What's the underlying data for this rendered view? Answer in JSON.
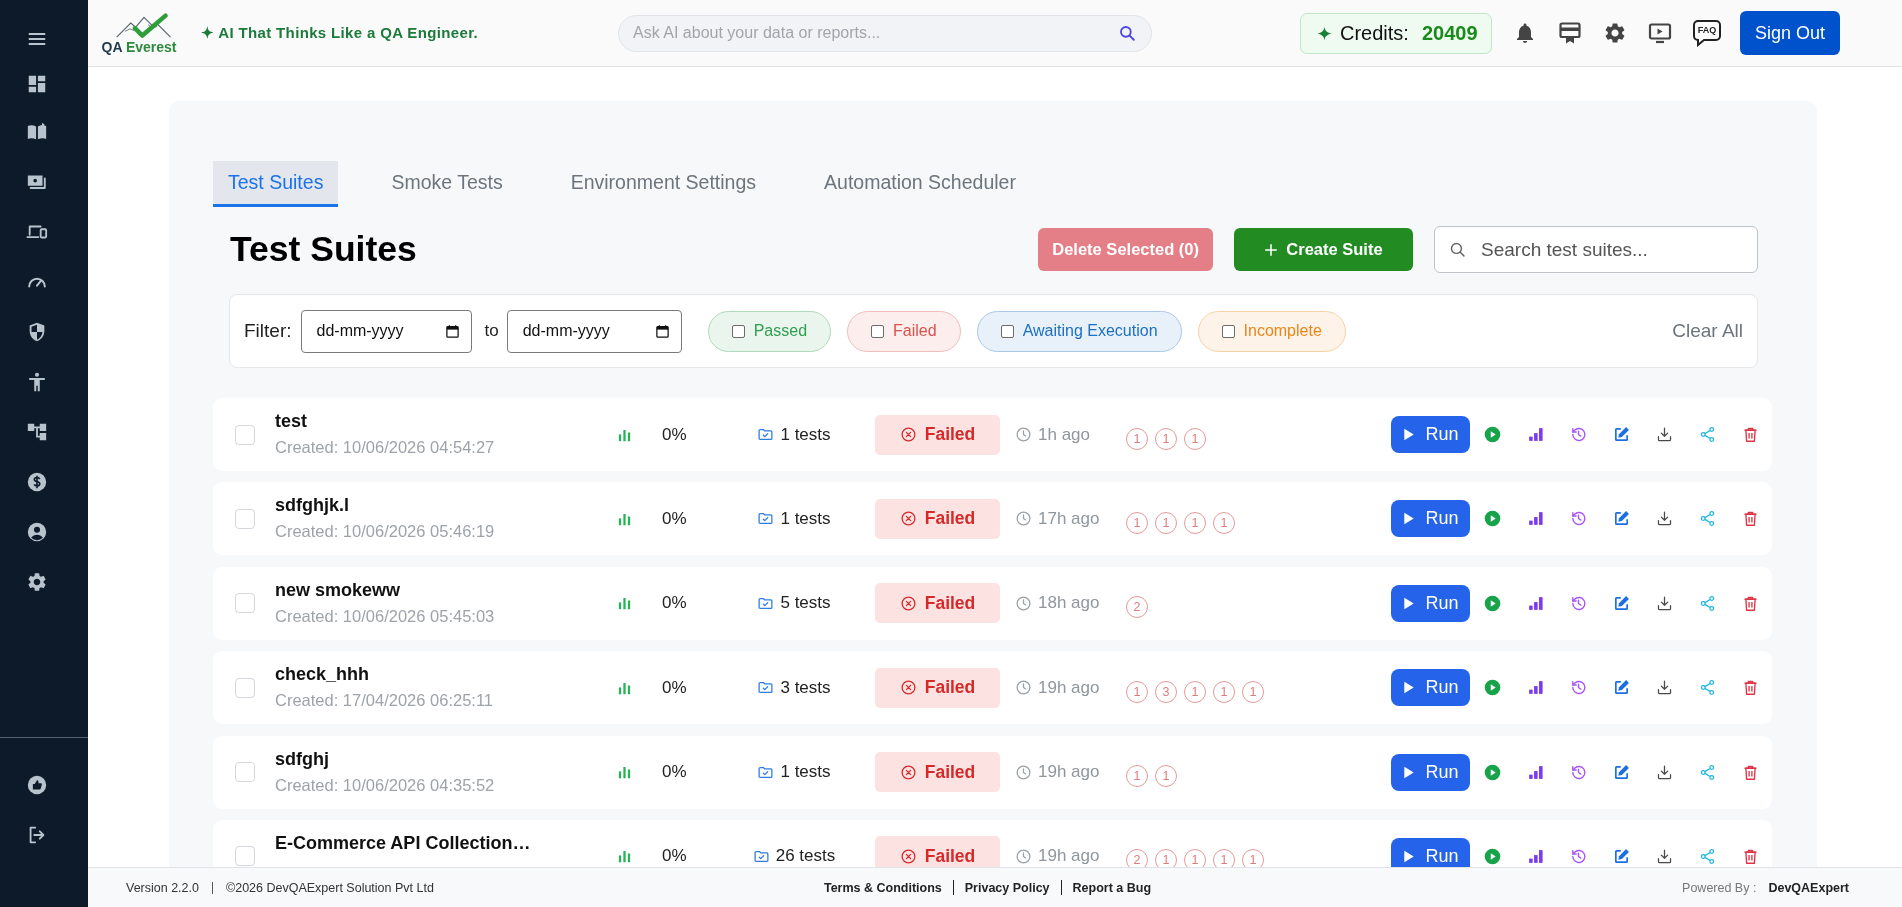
{
  "header": {
    "logo_words": [
      "QA",
      "Everest"
    ],
    "tagline": "✦ AI That Thinks Like a QA Engineer.",
    "ai_search": {
      "placeholder": "Ask AI about your data or reports..."
    },
    "credits": {
      "label": "Credits:",
      "value": "20409"
    },
    "faq": "FAQ",
    "sign_out": "Sign Out"
  },
  "tabs": [
    {
      "label": "Test Suites",
      "selected": true
    },
    {
      "label": "Smoke Tests",
      "selected": false
    },
    {
      "label": "Environment Settings",
      "selected": false
    },
    {
      "label": "Automation Scheduler",
      "selected": false
    }
  ],
  "title": "Test Suites",
  "actions": {
    "delete": {
      "label": "Delete Selected (0)",
      "disabled": true
    },
    "create": {
      "label": "Create Suite"
    },
    "search": {
      "placeholder": "Search test suites..."
    }
  },
  "filter": {
    "label": "Filter:",
    "from": {
      "placeholder": "dd-mm-yyyy"
    },
    "to_label": "to",
    "to": {
      "placeholder": "dd-mm-yyyy"
    },
    "chips": [
      {
        "label": "Passed",
        "color": "#2e9e4f",
        "checked": false
      },
      {
        "label": "Failed",
        "color": "#d9534f",
        "checked": false
      },
      {
        "label": "Awaiting Execution",
        "color": "#1d6fc2",
        "checked": false
      },
      {
        "label": "Incomplete",
        "color": "#e8861a",
        "checked": false
      }
    ],
    "clear": "Clear All"
  },
  "rows": [
    {
      "name": "test",
      "created": "Created: 10/06/2026 04:54:27",
      "checked": false,
      "pass_rate": "0%",
      "tests": "1 tests",
      "status": {
        "label": "Failed",
        "kind": "failed"
      },
      "last_run": "1h ago",
      "run_counts": [
        "1",
        "1",
        "1"
      ],
      "run": "Run"
    },
    {
      "name": "sdfghjk.l",
      "created": "Created: 10/06/2026 05:46:19",
      "checked": false,
      "pass_rate": "0%",
      "tests": "1 tests",
      "status": {
        "label": "Failed",
        "kind": "failed"
      },
      "last_run": "17h ago",
      "run_counts": [
        "1",
        "1",
        "1",
        "1"
      ],
      "run": "Run"
    },
    {
      "name": "new smokeww",
      "created": "Created: 10/06/2026 05:45:03",
      "checked": false,
      "pass_rate": "0%",
      "tests": "5 tests",
      "status": {
        "label": "Failed",
        "kind": "failed"
      },
      "last_run": "18h ago",
      "run_counts": [
        "2"
      ],
      "run": "Run"
    },
    {
      "name": "check_hhh",
      "created": "Created: 17/04/2026 06:25:11",
      "checked": false,
      "pass_rate": "0%",
      "tests": "3 tests",
      "status": {
        "label": "Failed",
        "kind": "failed"
      },
      "last_run": "19h ago",
      "run_counts": [
        "1",
        "3",
        "1",
        "1",
        "1"
      ],
      "run": "Run"
    },
    {
      "name": "sdfghj",
      "created": "Created: 10/06/2026 04:35:52",
      "checked": false,
      "pass_rate": "0%",
      "tests": "1 tests",
      "status": {
        "label": "Failed",
        "kind": "failed"
      },
      "last_run": "19h ago",
      "run_counts": [
        "1",
        "1"
      ],
      "run": "Run"
    },
    {
      "name": "E-Commerce API Collection…",
      "checked": false,
      "pass_rate": "0%",
      "tests": "26 tests",
      "status": {
        "label": "Failed",
        "kind": "failed"
      },
      "last_run": "19h ago",
      "run_counts": [
        "2",
        "1",
        "1",
        "1",
        "1"
      ],
      "run": "Run"
    }
  ],
  "footer": {
    "version": "Version 2.2.0",
    "copyright": "©2026 DevQAExpert Solution Pvt Ltd",
    "links": [
      "Terms & Conditions",
      "Privacy Policy",
      "Report a Bug"
    ],
    "powered_label": "Powered By :",
    "powered_by": "DevQAExpert"
  }
}
